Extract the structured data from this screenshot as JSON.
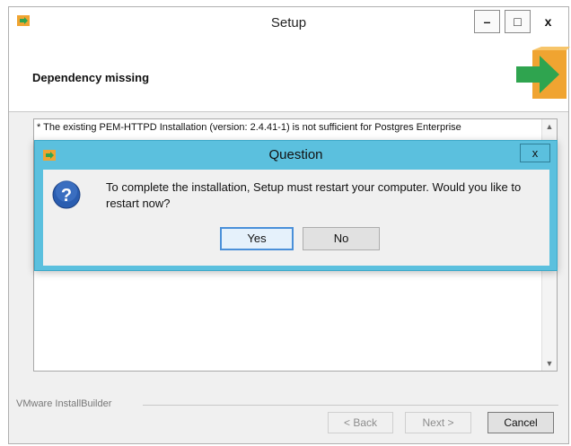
{
  "window": {
    "title": "Setup",
    "minimize_glyph": "–",
    "maximize_glyph": "□",
    "close_glyph": "x"
  },
  "header": {
    "title": "Dependency missing"
  },
  "content": {
    "text": "* The existing PEM-HTTPD Installation (version: 2.4.41-1) is not sufficient for Postgres Enterprise"
  },
  "footer": {
    "brand": "VMware InstallBuilder",
    "back_label": "< Back",
    "next_label": "Next >",
    "cancel_label": "Cancel"
  },
  "dialog": {
    "title": "Question",
    "close_glyph": "x",
    "message": "To complete the installation, Setup must restart your computer. Would you like to restart now?",
    "yes_label": "Yes",
    "no_label": "No"
  },
  "colors": {
    "dialog_frame": "#5bc0de",
    "question_icon": "#2a5db0",
    "box_orange": "#f0a431",
    "arrow_green": "#2fa44f"
  },
  "icons": {
    "app": "setup-app-icon",
    "header": "installer-box-icon",
    "dialog": "question-icon"
  }
}
